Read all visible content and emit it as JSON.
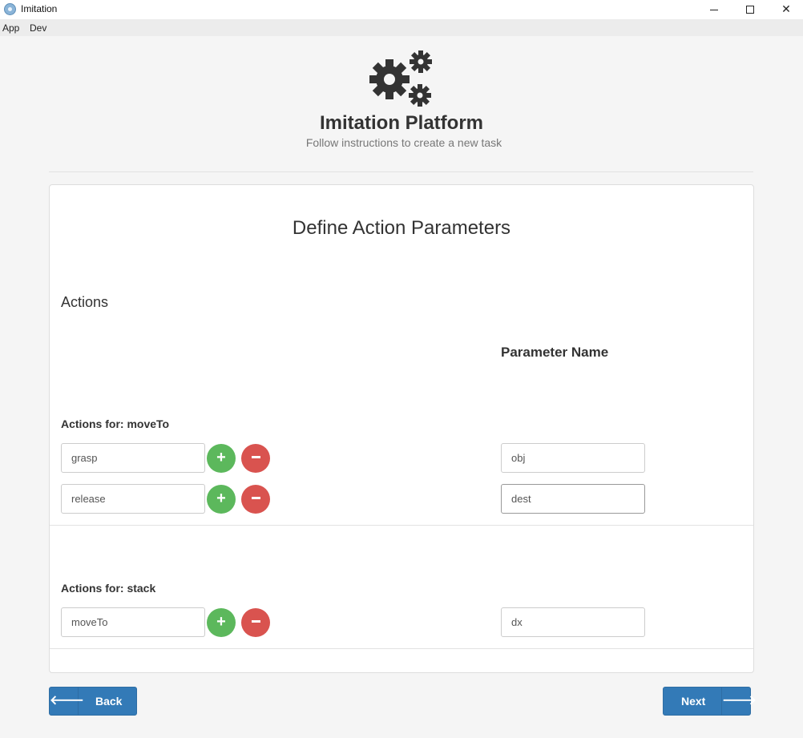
{
  "window": {
    "title": "Imitation",
    "icon": "electron-icon",
    "controls": [
      "minimize-icon",
      "maximize-icon",
      "close-icon"
    ]
  },
  "menu": {
    "items": [
      {
        "label": "App"
      },
      {
        "label": "Dev"
      }
    ]
  },
  "header": {
    "icon": "gears-icon",
    "title": "Imitation Platform",
    "subtitle": "Follow instructions to create a new task"
  },
  "panel": {
    "title": "Define Action Parameters",
    "actions_heading": "Actions",
    "parameter_heading": "Parameter Name",
    "groups": [
      {
        "label": "Actions for: moveTo",
        "rows": [
          {
            "action": "grasp",
            "parameter": "obj"
          },
          {
            "action": "release",
            "parameter": "dest"
          }
        ]
      },
      {
        "label": "Actions for: stack",
        "rows": [
          {
            "action": "moveTo",
            "parameter": "dx"
          }
        ]
      }
    ]
  },
  "buttons": {
    "plus_symbol": "+",
    "back": "Back",
    "next": "Next"
  },
  "colors": {
    "primary": "#337ab7",
    "success": "#5cb85c",
    "danger": "#d9534f",
    "background": "#f5f5f5"
  }
}
